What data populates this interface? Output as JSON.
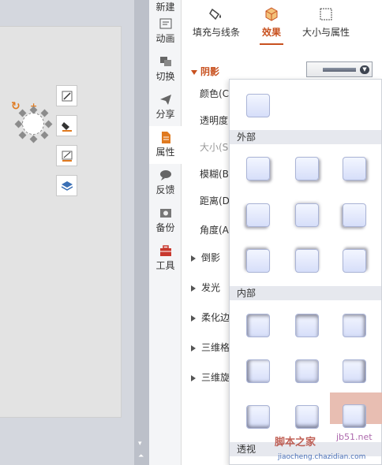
{
  "side_tabs": [
    {
      "label": "新建",
      "icon": "new-icon"
    },
    {
      "label": "动画",
      "icon": "animation-icon"
    },
    {
      "label": "切换",
      "icon": "transition-icon"
    },
    {
      "label": "分享",
      "icon": "share-icon"
    },
    {
      "label": "属性",
      "icon": "property-icon",
      "active": true
    },
    {
      "label": "反馈",
      "icon": "feedback-icon"
    },
    {
      "label": "备份",
      "icon": "backup-icon"
    },
    {
      "label": "工具",
      "icon": "toolbox-icon"
    }
  ],
  "top_tabs": [
    {
      "label": "填充与线条",
      "icon": "fill-bucket-icon"
    },
    {
      "label": "效果",
      "icon": "effect-cube-icon",
      "active": true
    },
    {
      "label": "大小与属性",
      "icon": "size-frame-icon"
    }
  ],
  "shadow": {
    "heading": "阴影",
    "rows": [
      "颜色(C)",
      "透明度",
      "大小(S)",
      "模糊(B)",
      "距离(D)",
      "角度(A)"
    ]
  },
  "sub_sections": [
    "倒影",
    "发光",
    "柔化边",
    "三维格",
    "三维旋"
  ],
  "popup": {
    "groups": [
      "外部",
      "内部",
      "透视"
    ]
  },
  "watermark": {
    "text1": "脚本之家",
    "text2": "jiaocheng.chazidian.com",
    "text3": "jb51.net"
  },
  "colors": {
    "accent": "#c8511f",
    "active_tab": "#c8511f"
  }
}
